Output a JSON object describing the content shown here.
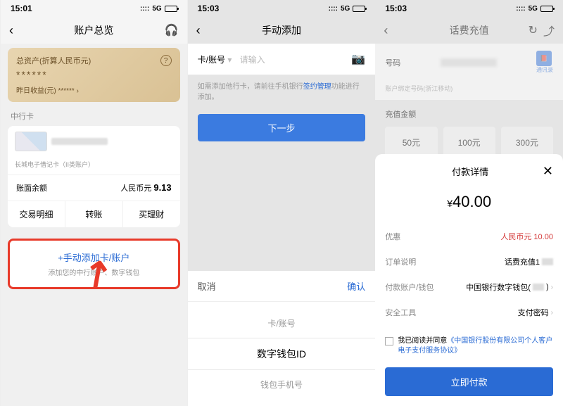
{
  "s1": {
    "time": "15:01",
    "network": "5G",
    "title": "账户总览",
    "gold": {
      "label": "总资产(折算人民币元)",
      "stars": "******",
      "yesterday": "昨日收益(元) ******"
    },
    "section_label": "中行卡",
    "card": {
      "subname": "长城电子借记卡（II类账户）",
      "balance_label": "账面余额",
      "currency": "人民币元",
      "balance": "9.13",
      "actions": [
        "交易明细",
        "转账",
        "买理财"
      ]
    },
    "add": {
      "link": "+手动添加卡/账户",
      "sub": "添加您的中行账户、数字钱包"
    }
  },
  "s2": {
    "time": "15:03",
    "network": "5G",
    "title": "手动添加",
    "input_label": "卡/账号",
    "input_placeholder": "请输入",
    "tip_pre": "如需添加他行卡，请前往手机银行",
    "tip_link": "签约管理",
    "tip_post": "功能进行添加。",
    "next": "下一步",
    "picker": {
      "cancel": "取消",
      "confirm": "确认",
      "options": [
        "卡/账号",
        "数字钱包ID",
        "钱包手机号"
      ],
      "selected_index": 1
    }
  },
  "s3": {
    "time": "15:03",
    "network": "5G",
    "title": "话费充值",
    "phone_label": "号码",
    "telecom_label": "通讯录",
    "bound_label": "账户绑定号码(浙江移动)",
    "amount_title": "充值金额",
    "amounts": [
      "50元",
      "100元",
      "300元"
    ],
    "pay": {
      "title": "付款详情",
      "amount": "40.00",
      "currency": "¥",
      "rows": {
        "discount_k": "优惠",
        "discount_v": "人民币元 10.00",
        "order_k": "订单说明",
        "order_v": "话费充值1",
        "account_k": "付款账户/钱包",
        "account_v": "中国银行数字钱包(",
        "tool_k": "安全工具",
        "tool_v": "支付密码"
      },
      "agree_pre": "我已阅读并同意",
      "agree_link": "《中国银行股份有限公司个人客户电子支付服务协议》",
      "button": "立即付款"
    }
  }
}
